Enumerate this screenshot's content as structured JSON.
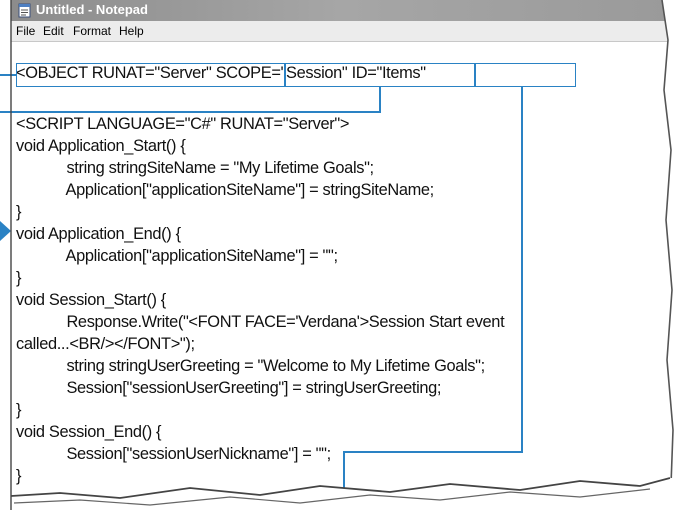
{
  "window": {
    "title": "Untitled - Notepad"
  },
  "menubar": {
    "items": [
      "File",
      "Edit",
      "Format",
      "Help"
    ]
  },
  "editor": {
    "lines": [
      "<OBJECT RUNAT=\"Server\" SCOPE=\"Session\" ID=\"Items\"",
      "",
      "<SCRIPT LANGUAGE=\"C#\" RUNAT=\"Server\">",
      "void Application_Start() {",
      "            string stringSiteName = \"My Lifetime Goals\";",
      "            Application[\"applicationSiteName\"] = stringSiteName;",
      "}",
      "void Application_End() {",
      "            Application[\"applicationSiteName\"] = \"\";",
      "}",
      "void Session_Start() {",
      "            Response.Write(\"<FONT FACE='Verdana'>Session Start event",
      "called...<BR/></FONT>\");",
      "            string stringUserGreeting = \"Welcome to My Lifetime Goals\";",
      "            Session[\"sessionUserGreeting\"] = stringUserGreeting;",
      "}",
      "void Session_End() {",
      "            Session[\"sessionUserNickname\"] = \"\";",
      "}"
    ]
  },
  "colors": {
    "callout": "#2a82c4",
    "titlebar": "#9a9a9a"
  }
}
